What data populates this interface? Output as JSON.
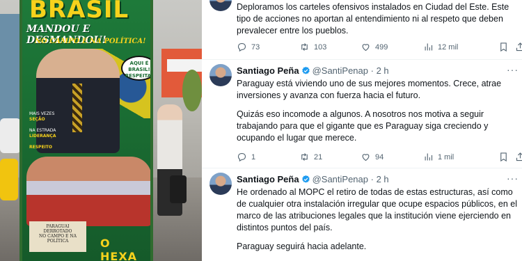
{
  "photo": {
    "banner_title": "BRASIL",
    "banner_line1": "MANDOU E DESMANDOU!",
    "banner_line2": "NO CAMPO E NA POLÍTICA!",
    "speech_bubble": [
      "AQUI É",
      "BRASIL!",
      "RESPEITA!"
    ],
    "banner_list": [
      {
        "label": "MAIS VEZES",
        "value": "SEÇÃO"
      },
      {
        "label": "NA ESTRADA",
        "value": "LIDERANÇA"
      },
      {
        "label": "",
        "value": "RESPEITO"
      }
    ],
    "plaque_text": [
      "PARAGUAI",
      "DERROTADO",
      "NO CAMPO E NA POLÍTICA"
    ],
    "bottom_brand": "O HEXA"
  },
  "feed": {
    "tweets": [
      {
        "name": "",
        "handle": "",
        "time": "",
        "body": [
          "Deploramos los carteles ofensivos instalados en Ciudad del Este. Este tipo de acciones no aportan al entendimiento ni al respeto que deben prevalecer entre los pueblos."
        ],
        "replies": "73",
        "retweets": "103",
        "likes": "499",
        "views": "12 mil"
      },
      {
        "name": "Santiago Peña",
        "handle": "@SantiPenap",
        "time": "2 h",
        "body": [
          "Paraguay está viviendo uno de sus mejores momentos. Crece, atrae inversiones y avanza con fuerza hacia el futuro.",
          "Quizás eso incomode a algunos. A nosotros nos motiva a seguir trabajando para que el gigante que es Paraguay siga creciendo y ocupando el lugar que merece."
        ],
        "replies": "1",
        "retweets": "21",
        "likes": "94",
        "views": "1 mil"
      },
      {
        "name": "Santiago Peña",
        "handle": "@SantiPenap",
        "time": "2 h",
        "body": [
          "He ordenado al MOPC el retiro de todas de estas estructuras, así como de cualquier otra instalación irregular que ocupe espacios públicos, en el marco de las atribuciones legales que la institución viene ejerciendo en distintos puntos del país.",
          "Paraguay seguirá hacia adelante."
        ]
      }
    ],
    "dot": "·",
    "more": "···",
    "icons": [
      "reply-icon",
      "retweet-icon",
      "like-icon",
      "views-icon",
      "bookmark-icon",
      "share-icon",
      "verified-badge-icon"
    ],
    "accent": "#1d9bf0"
  }
}
